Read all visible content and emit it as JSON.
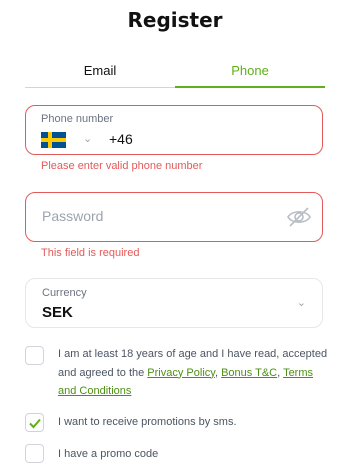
{
  "title": "Register",
  "tabs": [
    {
      "label": "Email",
      "active": false
    },
    {
      "label": "Phone",
      "active": true
    }
  ],
  "phone": {
    "label": "Phone number",
    "country": "Sweden",
    "dial_code": "+46",
    "error": "Please enter valid phone number"
  },
  "password": {
    "placeholder": "Password",
    "error": "This field is required"
  },
  "currency": {
    "label": "Currency",
    "value": "SEK"
  },
  "age_check": {
    "checked": false,
    "text_1": "I am at least 18 years of age and I have read, accepted and agreed to the ",
    "privacy_link": "Privacy Policy",
    "sep_1": ", ",
    "bonus_link": "Bonus T&C",
    "sep_2": ", ",
    "terms_link": "Terms and Conditions"
  },
  "sms_check": {
    "checked": true,
    "label": "I want to receive promotions by sms."
  },
  "promo_check": {
    "checked": false,
    "label": "I have a promo code"
  },
  "colors": {
    "accent": "#5fb01b",
    "error": "#e35a5a"
  },
  "icons": [
    "sweden-flag-icon",
    "chevron-down-icon",
    "eye-off-icon",
    "checkmark-icon"
  ]
}
